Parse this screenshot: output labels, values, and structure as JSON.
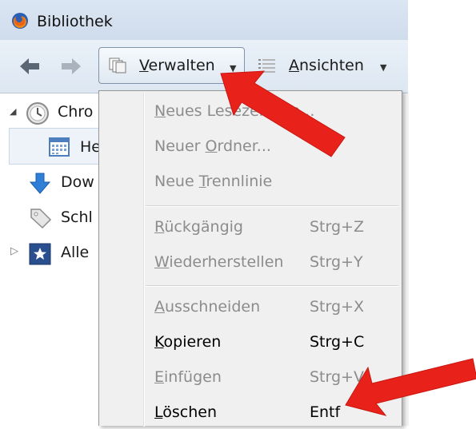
{
  "window": {
    "title": "Bibliothek"
  },
  "toolbar": {
    "manage": {
      "label_u": "V",
      "label_rest": "erwalten"
    },
    "views": {
      "label_u": "A",
      "label_rest": "nsichten"
    }
  },
  "sidebar": {
    "items": [
      {
        "label": "Chro"
      },
      {
        "label": "He"
      },
      {
        "label": "Dow"
      },
      {
        "label": "Schl"
      },
      {
        "label": "Alle"
      }
    ]
  },
  "menu": {
    "items": [
      {
        "pre": "",
        "u": "N",
        "post": "eues Lesezeichen...",
        "shortcut": ""
      },
      {
        "pre": "Neuer ",
        "u": "O",
        "post": "rdner...",
        "shortcut": ""
      },
      {
        "pre": "Neue ",
        "u": "T",
        "post": "rennlinie",
        "shortcut": ""
      },
      {
        "pre": "",
        "u": "R",
        "post": "ückgängig",
        "shortcut": "Strg+Z"
      },
      {
        "pre": "",
        "u": "W",
        "post": "iederherstellen",
        "shortcut": "Strg+Y"
      },
      {
        "pre": "",
        "u": "A",
        "post": "usschneiden",
        "shortcut": "Strg+X"
      },
      {
        "pre": "",
        "u": "K",
        "post": "opieren",
        "shortcut": "Strg+C"
      },
      {
        "pre": "",
        "u": "E",
        "post": "infügen",
        "shortcut": "Strg+V"
      },
      {
        "pre": "",
        "u": "L",
        "post": "öschen",
        "shortcut": "Entf"
      }
    ]
  },
  "colors": {
    "annotation_arrow": "#e8221b",
    "disabled_text": "#8c8c8c"
  }
}
